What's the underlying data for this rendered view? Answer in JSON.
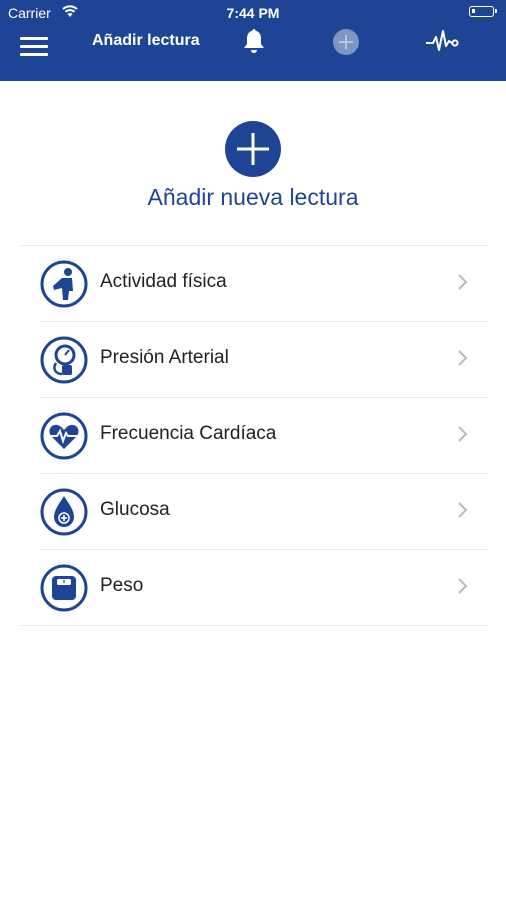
{
  "status_bar": {
    "carrier": "Carrier",
    "time": "7:44 PM"
  },
  "navbar": {
    "title": "Añadir lectura",
    "icons": [
      "menu-icon",
      "bell-icon",
      "add-circle-icon",
      "pulse-icon"
    ]
  },
  "hero": {
    "title": "Añadir nueva lectura",
    "icon": "plus-icon"
  },
  "colors": {
    "primary": "#1e4595",
    "divider": "#ececec",
    "chevron": "#b9b9b9",
    "text": "#222222"
  },
  "readings": [
    {
      "label": "Actividad física",
      "icon": "physical-activity-icon"
    },
    {
      "label": "Presión Arterial",
      "icon": "blood-pressure-icon"
    },
    {
      "label": "Frecuencia Cardíaca",
      "icon": "heart-rate-icon"
    },
    {
      "label": "Glucosa",
      "icon": "glucose-icon"
    },
    {
      "label": "Peso",
      "icon": "weight-scale-icon"
    }
  ]
}
